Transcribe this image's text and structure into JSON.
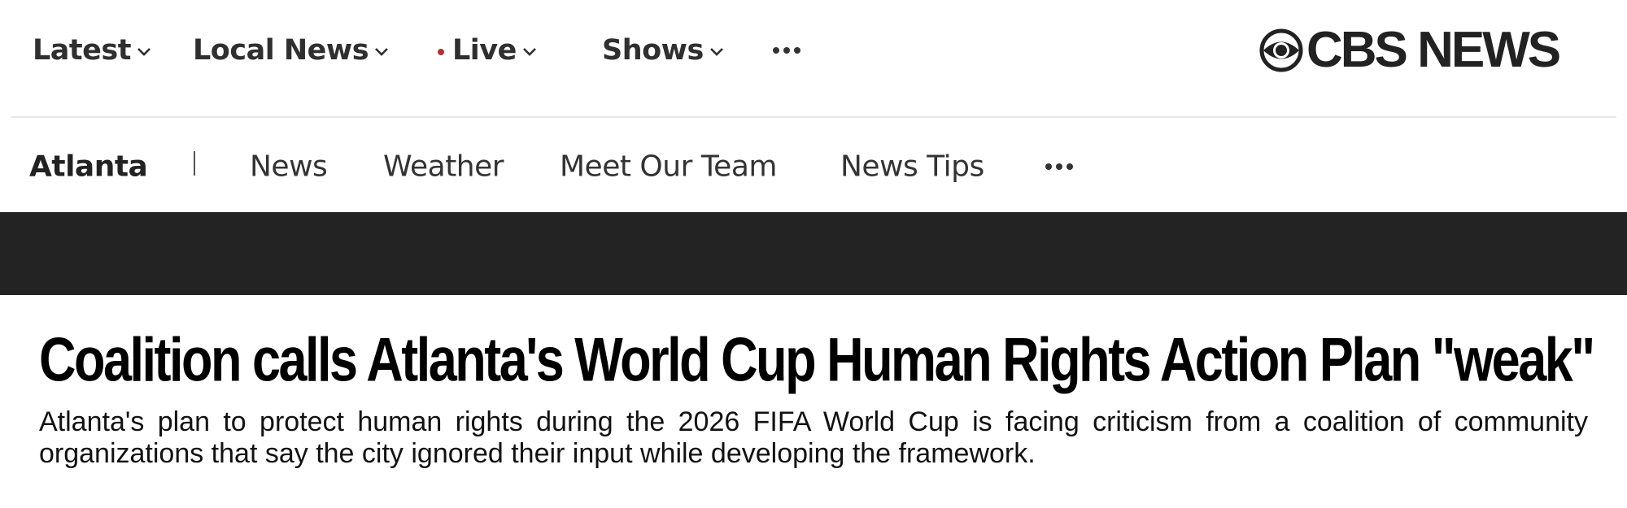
{
  "top_nav": {
    "items": [
      {
        "label": "Latest"
      },
      {
        "label": "Local News"
      },
      {
        "label": "Live"
      },
      {
        "label": "Shows"
      }
    ],
    "more_icon": "ellipsis-icon"
  },
  "logo": {
    "text": "CBS NEWS",
    "icon": "cbs-eye-icon"
  },
  "sub_nav": {
    "brand": "Atlanta",
    "items": [
      {
        "label": "News"
      },
      {
        "label": "Weather"
      },
      {
        "label": "Meet Our Team"
      },
      {
        "label": "News Tips"
      }
    ],
    "more_icon": "ellipsis-icon"
  },
  "article": {
    "headline": "Coalition calls Atlanta's World Cup Human Rights Action Plan \"weak\"",
    "dek": "Atlanta's plan to protect human rights during the 2026 FIFA World Cup is facing criticism from a coalition of community organizations that say the city ignored their input while developing the framework."
  },
  "colors": {
    "live_dot": "#b5312d",
    "banner": "#232323",
    "text": "#222222"
  }
}
